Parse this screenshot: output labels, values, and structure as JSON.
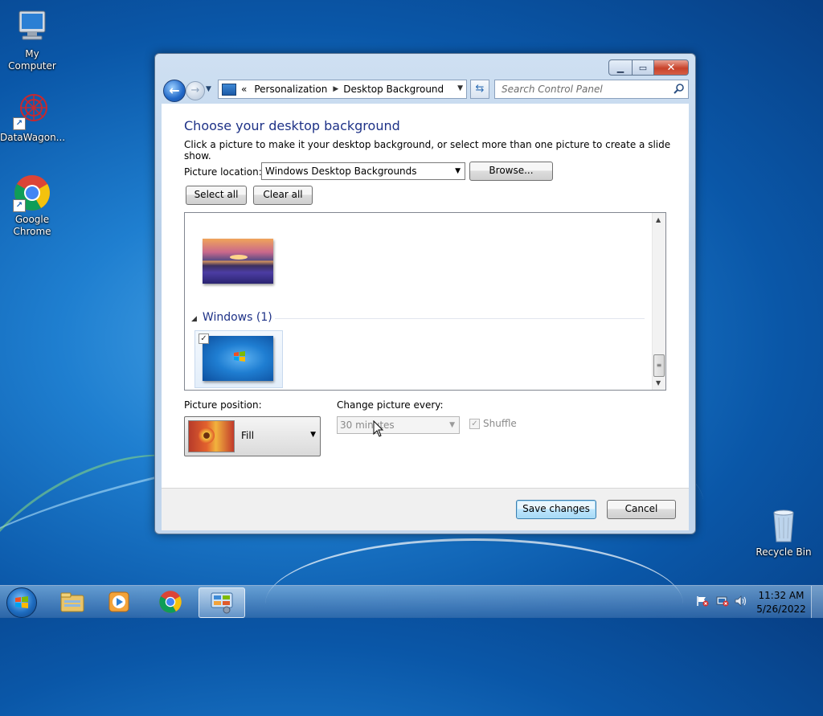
{
  "desktop": {
    "icons": [
      {
        "label": "My Computer"
      },
      {
        "label": "DataWagon..."
      },
      {
        "label": "Google Chrome"
      },
      {
        "label": "Recycle Bin"
      }
    ]
  },
  "window": {
    "address": {
      "overflow": "«",
      "crumbs": [
        "Personalization",
        "Desktop Background"
      ]
    },
    "search": {
      "placeholder": "Search Control Panel"
    },
    "heading": "Choose your desktop background",
    "subtext": "Click a picture to make it your desktop background, or select more than one picture to create a slide show.",
    "picture_location": {
      "label": "Picture location:",
      "value": "Windows Desktop Backgrounds",
      "browse_label": "Browse..."
    },
    "select_all_label": "Select all",
    "clear_all_label": "Clear all",
    "picker": {
      "group_title": "Windows (1)",
      "windows_item_checked": true
    },
    "picture_position": {
      "label": "Picture position:",
      "value": "Fill"
    },
    "change_picture": {
      "label": "Change picture every:",
      "value": "30 minutes",
      "enabled": false
    },
    "shuffle": {
      "label": "Shuffle",
      "checked": true,
      "enabled": false
    },
    "save_label": "Save changes",
    "cancel_label": "Cancel"
  },
  "taskbar": {
    "clock": {
      "time": "11:32 AM",
      "date": "5/26/2022"
    },
    "pinned": [
      "file-explorer-icon",
      "media-player-icon",
      "chrome-icon",
      "control-panel-icon"
    ],
    "active": "control-panel-icon"
  }
}
